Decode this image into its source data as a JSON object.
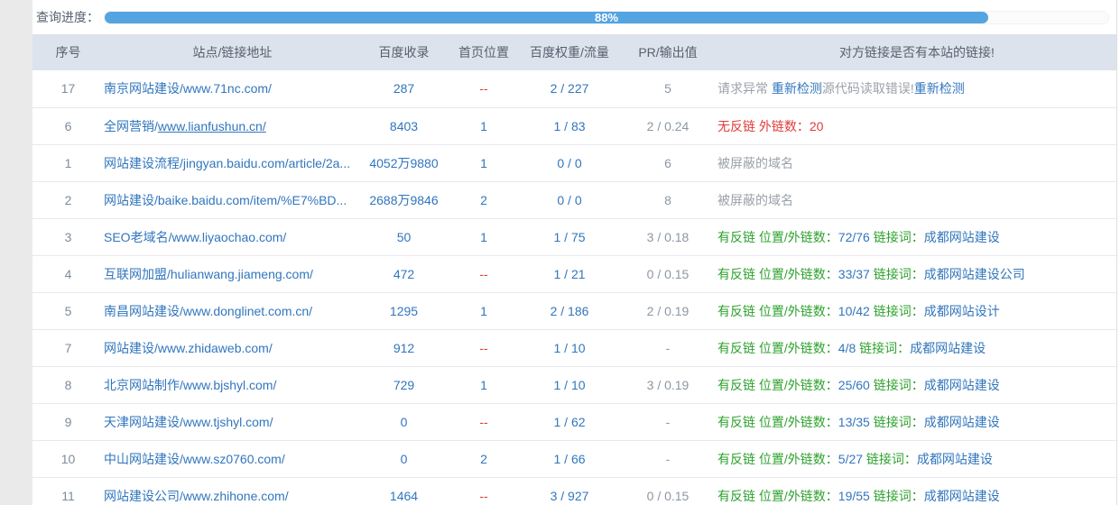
{
  "progress": {
    "label": "查询进度：",
    "percent_text": "88%",
    "percent_value": 88,
    "fill_color": "#55a4e2"
  },
  "table": {
    "headers": [
      "序号",
      "站点/链接地址",
      "百度收录",
      "首页位置",
      "百度权重/流量",
      "PR/输出值",
      "对方链接是否有本站的链接!"
    ],
    "rows": [
      {
        "no": "17",
        "site_name": "南京网站建设/",
        "site_url": "www.71nc.com/",
        "underline": false,
        "baidu_index": "287",
        "home_pos": "--",
        "home_style": "red",
        "weight": "2 / 227",
        "pr": "5",
        "remark": [
          {
            "t": "请求异常 ",
            "s": "gray"
          },
          {
            "t": "重新检测",
            "s": "link"
          },
          {
            "t": "源代码读取错误!",
            "s": "gray"
          },
          {
            "t": "重新检测",
            "s": "link"
          }
        ]
      },
      {
        "no": "6",
        "site_name": "全网营销/",
        "site_url": "www.lianfushun.cn/",
        "underline": true,
        "baidu_index": "8403",
        "home_pos": "1",
        "home_style": "blue",
        "weight": "1 / 83",
        "pr": "2 / 0.24",
        "remark": [
          {
            "t": "无反链 外链数：20",
            "s": "red"
          }
        ]
      },
      {
        "no": "1",
        "site_name": "网站建设流程/",
        "site_url": "jingyan.baidu.com/article/2a...",
        "underline": false,
        "baidu_index": "4052万9880",
        "home_pos": "1",
        "home_style": "blue",
        "weight": "0 / 0",
        "pr": "6",
        "remark": [
          {
            "t": "被屏蔽的域名",
            "s": "gray"
          }
        ]
      },
      {
        "no": "2",
        "site_name": "网站建设/",
        "site_url": "baike.baidu.com/item/%E7%BD...",
        "underline": false,
        "baidu_index": "2688万9846",
        "home_pos": "2",
        "home_style": "blue",
        "weight": "0 / 0",
        "pr": "8",
        "remark": [
          {
            "t": "被屏蔽的域名",
            "s": "gray"
          }
        ]
      },
      {
        "no": "3",
        "site_name": "SEO老域名/",
        "site_url": "www.liyaochao.com/",
        "underline": false,
        "baidu_index": "50",
        "home_pos": "1",
        "home_style": "blue",
        "weight": "1 / 75",
        "pr": "3 / 0.18",
        "remark": [
          {
            "t": "有反链 位置/外链数：",
            "s": "green"
          },
          {
            "t": "72/76",
            "s": "blue"
          },
          {
            "t": " 链接词：",
            "s": "green"
          },
          {
            "t": "成都网站建设",
            "s": "link"
          }
        ]
      },
      {
        "no": "4",
        "site_name": "互联网加盟/",
        "site_url": "hulianwang.jiameng.com/",
        "underline": false,
        "baidu_index": "472",
        "home_pos": "--",
        "home_style": "red",
        "weight": "1 / 21",
        "pr": "0 / 0.15",
        "remark": [
          {
            "t": "有反链 位置/外链数：",
            "s": "green"
          },
          {
            "t": "33/37",
            "s": "blue"
          },
          {
            "t": " 链接词：",
            "s": "green"
          },
          {
            "t": "成都网站建设公司",
            "s": "link"
          }
        ]
      },
      {
        "no": "5",
        "site_name": "南昌网站建设/",
        "site_url": "www.donglinet.com.cn/",
        "underline": false,
        "baidu_index": "1295",
        "home_pos": "1",
        "home_style": "blue",
        "weight": "2 / 186",
        "pr": "2 / 0.19",
        "remark": [
          {
            "t": "有反链 位置/外链数：",
            "s": "green"
          },
          {
            "t": "10/42",
            "s": "blue"
          },
          {
            "t": " 链接词：",
            "s": "green"
          },
          {
            "t": "成都网站设计",
            "s": "link"
          }
        ]
      },
      {
        "no": "7",
        "site_name": "网站建设/",
        "site_url": "www.zhidaweb.com/",
        "underline": false,
        "baidu_index": "912",
        "home_pos": "--",
        "home_style": "red",
        "weight": "1 / 10",
        "pr": "-",
        "remark": [
          {
            "t": "有反链 位置/外链数：",
            "s": "green"
          },
          {
            "t": "4/8",
            "s": "blue"
          },
          {
            "t": " 链接词：",
            "s": "green"
          },
          {
            "t": "成都网站建设",
            "s": "link"
          }
        ]
      },
      {
        "no": "8",
        "site_name": "北京网站制作/",
        "site_url": "www.bjshyl.com/",
        "underline": false,
        "baidu_index": "729",
        "home_pos": "1",
        "home_style": "blue",
        "weight": "1 / 10",
        "pr": "3 / 0.19",
        "remark": [
          {
            "t": "有反链 位置/外链数：",
            "s": "green"
          },
          {
            "t": "25/60",
            "s": "blue"
          },
          {
            "t": " 链接词：",
            "s": "green"
          },
          {
            "t": "成都网站建设",
            "s": "link"
          }
        ]
      },
      {
        "no": "9",
        "site_name": "天津网站建设/",
        "site_url": "www.tjshyl.com/",
        "underline": false,
        "baidu_index": "0",
        "home_pos": "--",
        "home_style": "red",
        "weight": "1 / 62",
        "pr": "-",
        "remark": [
          {
            "t": "有反链 位置/外链数：",
            "s": "green"
          },
          {
            "t": "13/35",
            "s": "blue"
          },
          {
            "t": " 链接词：",
            "s": "green"
          },
          {
            "t": "成都网站建设",
            "s": "link"
          }
        ]
      },
      {
        "no": "10",
        "site_name": "中山网站建设/",
        "site_url": "www.sz0760.com/",
        "underline": false,
        "baidu_index": "0",
        "home_pos": "2",
        "home_style": "blue",
        "weight": "1 / 66",
        "pr": "-",
        "remark": [
          {
            "t": "有反链 位置/外链数：",
            "s": "green"
          },
          {
            "t": "5/27",
            "s": "blue"
          },
          {
            "t": " 链接词：",
            "s": "green"
          },
          {
            "t": "成都网站建设",
            "s": "link"
          }
        ]
      },
      {
        "no": "11",
        "site_name": "网站建设公司/",
        "site_url": "www.zhihone.com/",
        "underline": false,
        "baidu_index": "1464",
        "home_pos": "--",
        "home_style": "red",
        "weight": "3 / 927",
        "pr": "0 / 0.15",
        "remark": [
          {
            "t": "有反链 位置/外链数：",
            "s": "green"
          },
          {
            "t": "19/55",
            "s": "blue"
          },
          {
            "t": " 链接词：",
            "s": "green"
          },
          {
            "t": "成都网站建设",
            "s": "link"
          }
        ]
      }
    ]
  }
}
